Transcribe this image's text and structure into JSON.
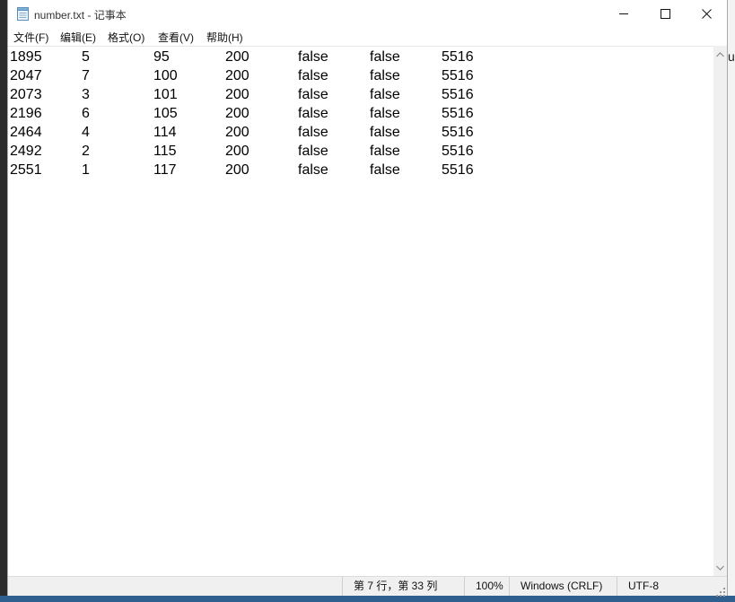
{
  "window": {
    "title": "number.txt - 记事本"
  },
  "menu": [
    "文件(F)",
    "编辑(E)",
    "格式(O)",
    "查看(V)",
    "帮助(H)"
  ],
  "rows": [
    [
      "1895",
      "5",
      "95",
      "200",
      "false",
      "false",
      "5516"
    ],
    [
      "2047",
      "7",
      "100",
      "200",
      "false",
      "false",
      "5516"
    ],
    [
      "2073",
      "3",
      "101",
      "200",
      "false",
      "false",
      "5516"
    ],
    [
      "2196",
      "6",
      "105",
      "200",
      "false",
      "false",
      "5516"
    ],
    [
      "2464",
      "4",
      "114",
      "200",
      "false",
      "false",
      "5516"
    ],
    [
      "2492",
      "2",
      "115",
      "200",
      "false",
      "false",
      "5516"
    ],
    [
      "2551",
      "1",
      "117",
      "200",
      "false",
      "false",
      "5516"
    ]
  ],
  "status": {
    "position": "第 7 行，第 33 列",
    "zoom": "100%",
    "line_ending": "Windows (CRLF)",
    "encoding": "UTF-8"
  },
  "background_right_text": "u",
  "icons": [
    "notepad-icon",
    "minimize-icon",
    "maximize-icon",
    "close-icon",
    "scroll-up-icon",
    "scroll-down-icon",
    "resize-grip-icon"
  ]
}
